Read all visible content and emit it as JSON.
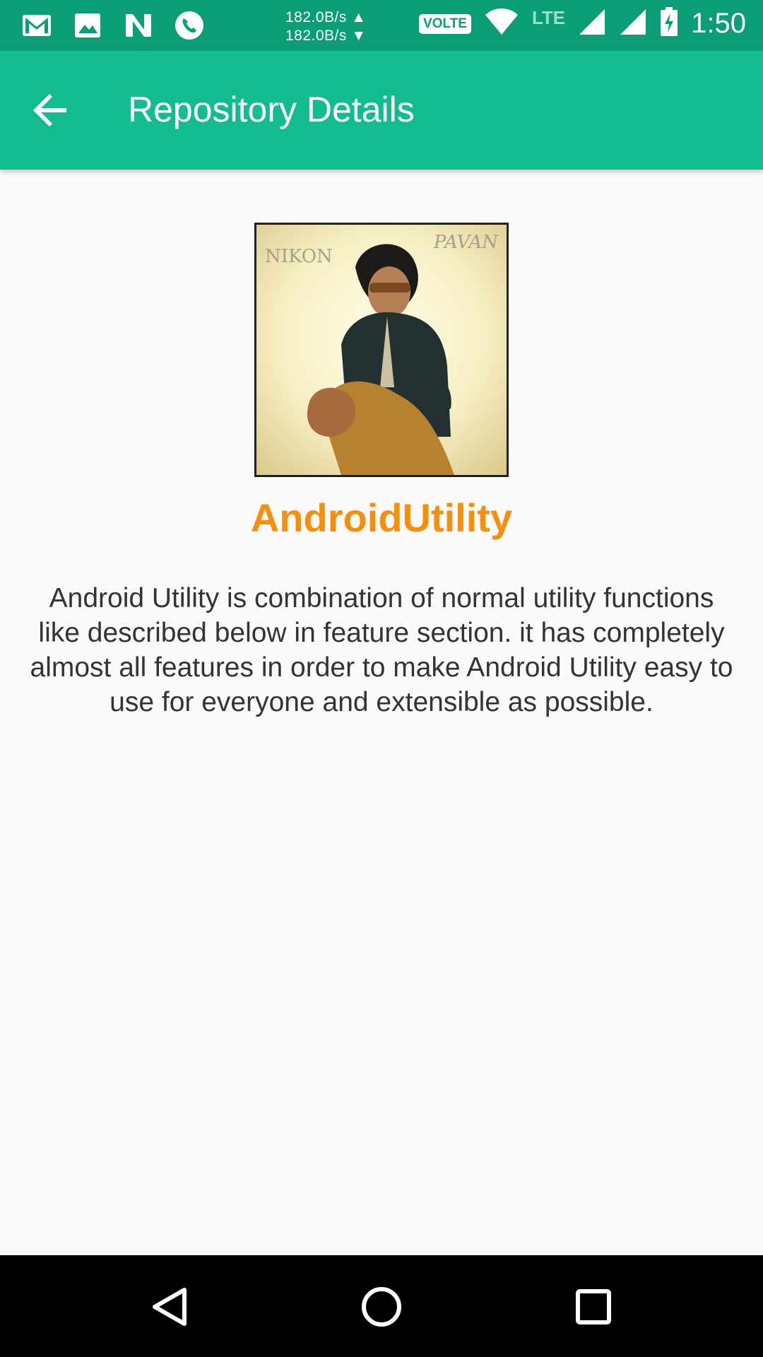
{
  "status_bar": {
    "left_icons": [
      "gmail-icon",
      "gallery-icon",
      "n-app-icon",
      "phone-call-icon"
    ],
    "upload_speed": "182.0B/s ▲",
    "download_speed": "182.0B/s ▼",
    "volte_label": "VOLTE",
    "lte_label": "LTE",
    "time": "1:50"
  },
  "app_bar": {
    "title": "Repository Details",
    "back_icon": "arrow-back-icon",
    "background_color": "#12bc8f"
  },
  "repository": {
    "avatar_texts": {
      "top_left": "NIKON",
      "top_right": "PAVAN"
    },
    "name": "AndroidUtility",
    "name_color": "#f5900f",
    "description": "Android Utility is combination of normal utility functions like described below in feature section. it has completely almost all features in order to make Android Utility easy to use for everyone and extensible as possible."
  },
  "nav_bar": {
    "buttons": [
      "back-triangle-icon",
      "home-circle-icon",
      "recents-square-icon"
    ]
  }
}
